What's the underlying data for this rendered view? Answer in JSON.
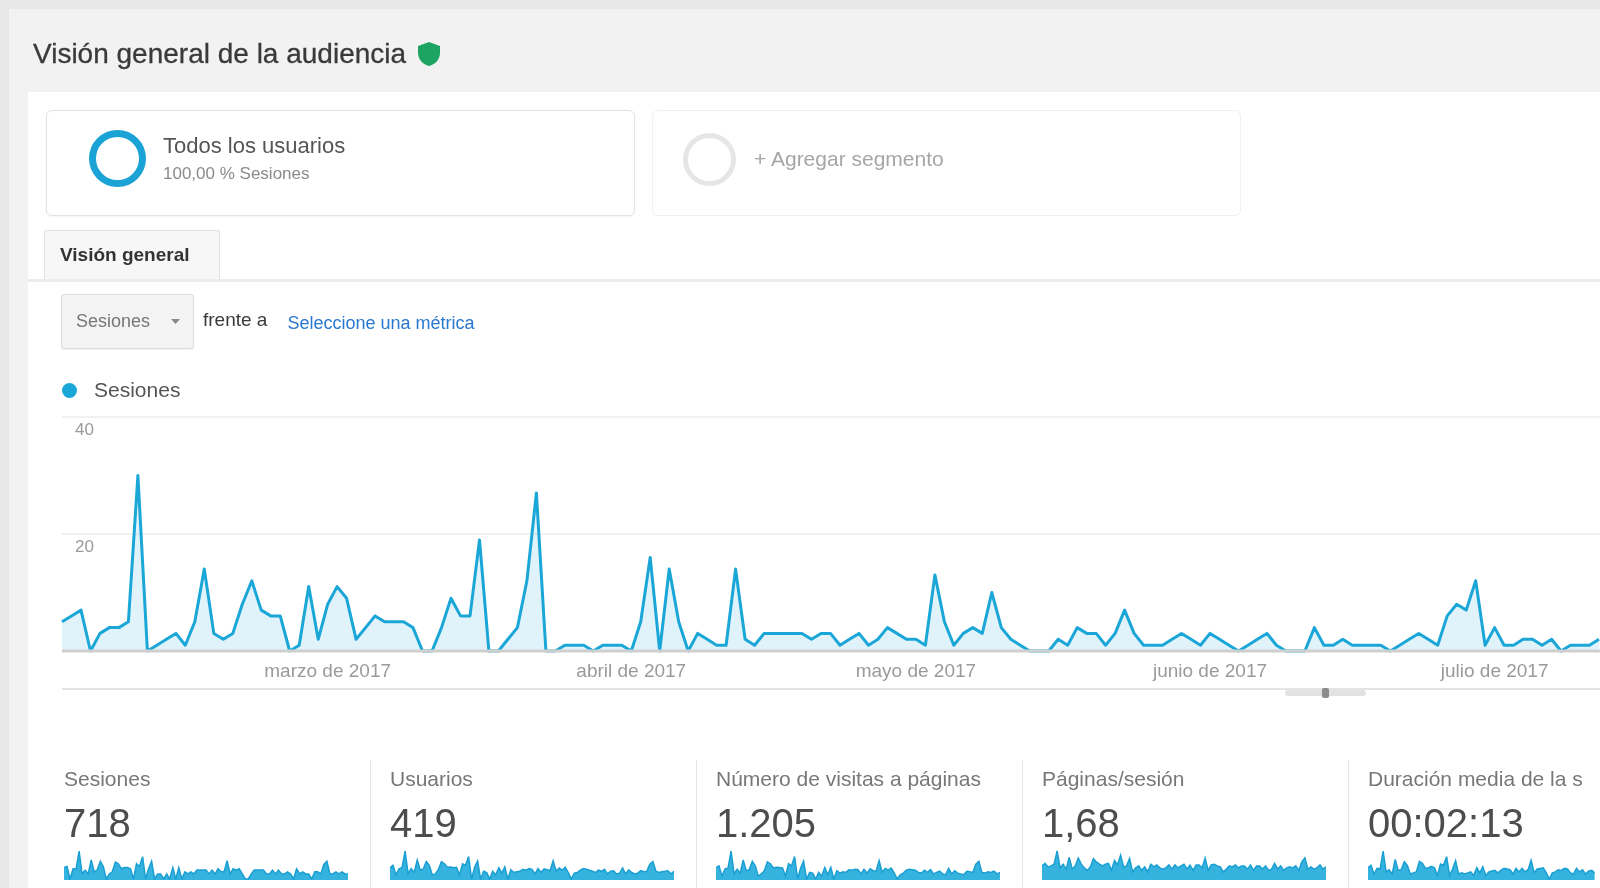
{
  "header": {
    "title": "Visión general de la audiencia"
  },
  "segments": [
    {
      "kind": "segment",
      "title": "Todos los usuarios",
      "subtitle": "100,00 % Sesiones",
      "color": "#1ba3d6"
    },
    {
      "kind": "add",
      "title": "+ Agregar segmento"
    }
  ],
  "tabs": [
    {
      "label": "Visión general",
      "selected": true
    }
  ],
  "overview": {
    "metric_selector": {
      "value": "Sesiones"
    },
    "compare_label": "frente a",
    "compare_link": "Seleccione una métrica",
    "chart_data": {
      "type": "area",
      "categories": [
        null,
        null,
        null,
        null,
        null,
        null,
        null,
        null,
        null,
        null,
        null,
        null,
        null,
        null,
        null,
        null,
        null,
        null,
        null,
        null,
        null,
        null,
        null,
        null,
        null,
        null,
        null,
        null,
        "marzo de 2017",
        null,
        null,
        null,
        null,
        null,
        null,
        null,
        null,
        null,
        null,
        null,
        null,
        null,
        null,
        null,
        null,
        null,
        null,
        null,
        null,
        null,
        null,
        null,
        null,
        null,
        null,
        null,
        null,
        null,
        null,
        null,
        "abril de 2017",
        null,
        null,
        null,
        null,
        null,
        null,
        null,
        null,
        null,
        null,
        null,
        null,
        null,
        null,
        null,
        null,
        null,
        null,
        null,
        null,
        null,
        null,
        null,
        null,
        null,
        null,
        null,
        null,
        null,
        "mayo de 2017",
        null,
        null,
        null,
        null,
        null,
        null,
        null,
        null,
        null,
        null,
        null,
        null,
        null,
        null,
        null,
        null,
        null,
        null,
        null,
        null,
        null,
        null,
        null,
        null,
        null,
        null,
        null,
        null,
        null,
        null,
        "junio de 2017",
        null,
        null,
        null,
        null,
        null,
        null,
        null,
        null,
        null,
        null,
        null,
        null,
        null,
        null,
        null,
        null,
        null,
        null,
        null,
        null,
        null,
        null,
        null,
        null,
        null,
        null,
        null,
        null,
        null,
        "julio de 2017",
        null,
        null,
        null,
        null,
        null,
        null,
        null,
        null,
        null,
        null,
        null
      ],
      "series": [
        {
          "name": "Sesiones",
          "color": "#1ba6d8",
          "values": [
            5,
            6,
            7,
            0,
            3,
            4,
            4,
            5,
            30,
            0,
            1,
            2,
            3,
            1,
            5,
            14,
            3,
            2,
            3,
            8,
            12,
            7,
            6,
            6,
            0,
            1,
            11,
            2,
            8,
            11,
            9,
            2,
            4,
            6,
            5,
            5,
            5,
            4,
            0,
            0,
            4,
            9,
            6,
            6,
            19,
            0,
            0,
            2,
            4,
            12,
            27,
            0,
            0,
            1,
            1,
            1,
            0,
            1,
            1,
            1,
            0,
            5,
            16,
            0,
            14,
            5,
            0,
            3,
            2,
            1,
            1,
            14,
            2,
            1,
            3,
            3,
            3,
            3,
            3,
            2,
            3,
            3,
            1,
            2,
            3,
            1,
            2,
            4,
            3,
            2,
            2,
            1,
            13,
            5,
            1,
            3,
            4,
            3,
            10,
            4,
            2,
            1,
            0,
            0,
            0,
            2,
            1,
            4,
            3,
            3,
            1,
            3,
            7,
            3,
            1,
            1,
            1,
            2,
            3,
            2,
            1,
            3,
            2,
            1,
            0,
            1,
            2,
            3,
            1,
            0,
            0,
            0,
            4,
            1,
            1,
            2,
            1,
            1,
            1,
            1,
            0,
            1,
            2,
            3,
            2,
            1,
            6,
            8,
            7,
            12,
            1,
            4,
            1,
            1,
            2,
            2,
            1,
            2,
            0,
            1,
            1,
            1,
            2
          ]
        }
      ],
      "ylim": [
        0,
        40
      ],
      "yticks": [
        20,
        40
      ]
    }
  },
  "metrics": [
    {
      "label": "Sesiones",
      "value": "718"
    },
    {
      "label": "Usuarios",
      "value": "419"
    },
    {
      "label": "Número de visitas a páginas",
      "value": "1.205"
    },
    {
      "label": "Páginas/sesión",
      "value": "1,68"
    },
    {
      "label": "Duración media de la s",
      "value": "00:02:13"
    }
  ]
}
